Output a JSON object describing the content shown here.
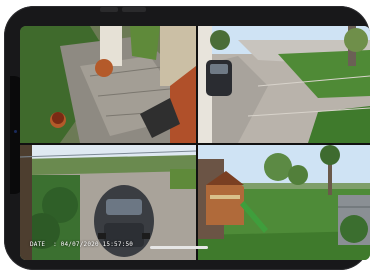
{
  "cameras": [
    {
      "icon": "front-porch-camera-icon"
    },
    {
      "icon": "street-side-camera-icon"
    },
    {
      "icon": "driveway-camera-icon"
    },
    {
      "icon": "backyard-camera-icon"
    }
  ],
  "overlay": {
    "date_label": "DATE",
    "date_value": ": 04/07/2020 15:57:50"
  },
  "colors": {
    "device_frame": "#18181a",
    "lawn": "#4f8a36",
    "pavement": "#b7b4ae",
    "sky": "#cfe3f4"
  }
}
